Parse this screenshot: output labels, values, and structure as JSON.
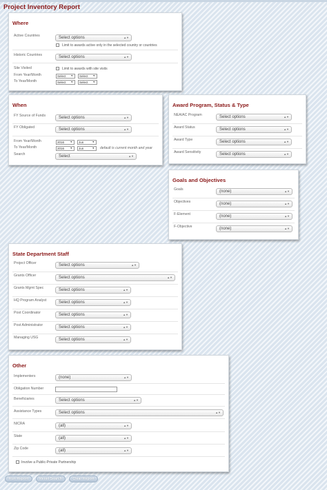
{
  "page": {
    "title": "Project Inventory Report"
  },
  "where": {
    "heading": "Where",
    "active_countries_label": "Active Countries",
    "active_countries_value": "Select options",
    "limit_country_label": "Limit to awards active only in the selected country or countries",
    "historic_countries_label": "Historic Countries",
    "historic_countries_value": "Select options",
    "site_visited_label": "Site Visited",
    "limit_site_label": "Limit to awards with site visits",
    "from_label": "From Year/Month",
    "to_label": "To Year/Month",
    "select_short": "Select"
  },
  "when": {
    "heading": "When",
    "fy_source_label": "FY Source of Funds",
    "fy_source_value": "Select options",
    "fy_obligated_label": "FY Obligated",
    "fy_obligated_value": "Select options",
    "from_label": "From Year/Month",
    "to_label": "To Year/Month",
    "year": "2016",
    "month": "Jun",
    "default_note": "default is current month and year",
    "search_label": "Search",
    "search_value": "Select"
  },
  "award": {
    "heading": "Award Program, Status & Type",
    "rows": [
      {
        "label": "NEA/AC Program",
        "value": "Select options"
      },
      {
        "label": "Award Status",
        "value": "Select options"
      },
      {
        "label": "Award Type",
        "value": "Select options"
      },
      {
        "label": "Award Sensitivity",
        "value": "Select options"
      }
    ]
  },
  "goals": {
    "heading": "Goals and Objectives",
    "rows": [
      {
        "label": "Goals",
        "value": "(none)"
      },
      {
        "label": "Objectives",
        "value": "(none)"
      },
      {
        "label": "F-Element",
        "value": "(none)"
      },
      {
        "label": "F-Objective",
        "value": "(none)"
      }
    ]
  },
  "staff": {
    "heading": "State Department Staff",
    "rows": [
      {
        "label": "Project Officer",
        "value": "Select options"
      },
      {
        "label": "Grants Officer",
        "value": "Select options"
      },
      {
        "label": "Grants Mgmt Spec",
        "value": "Select options"
      },
      {
        "label": "HQ Program Analyst",
        "value": "Select options"
      },
      {
        "label": "Post Coordinator",
        "value": "Select options"
      },
      {
        "label": "Post Administrator",
        "value": "Select options"
      },
      {
        "label": "Managing USG",
        "value": "Select options"
      }
    ]
  },
  "other": {
    "heading": "Other",
    "implementers_label": "Implementers",
    "implementers_value": "(none)",
    "obligation_label": "Obligation Number",
    "obligation_value": "",
    "beneficiaries_label": "Beneficiaries",
    "beneficiaries_value": "Select options",
    "assistance_label": "Assistance Types",
    "assistance_value": "Select options",
    "nicra_label": "NICRA",
    "nicra_value": "(all)",
    "state_label": "State",
    "state_value": "(all)",
    "zip_label": "Zip Code",
    "zip_value": "(all)",
    "ppp_label": "Involve a Public-Private Partnership"
  },
  "buttons": {
    "run": "Run Report",
    "reset": "Reset Search",
    "clear": "Clear Report"
  }
}
